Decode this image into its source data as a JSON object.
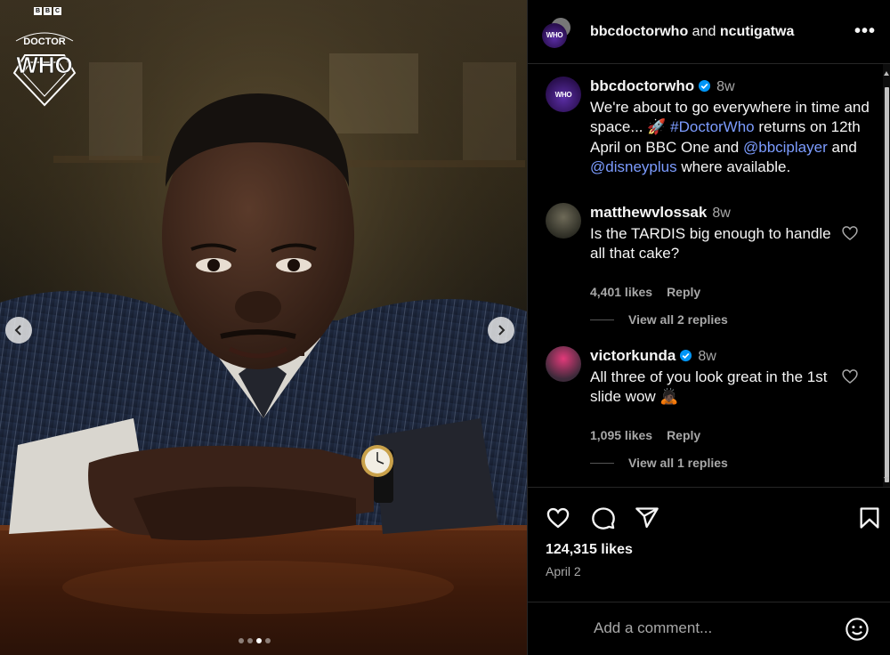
{
  "brand": {
    "bbc_letters": [
      "B",
      "B",
      "C"
    ],
    "logo_top": "DOCTOR",
    "logo_main": "WHO"
  },
  "media": {
    "prev_icon": "chevron-left-icon",
    "next_icon": "chevron-right-icon",
    "slide_count": 4,
    "active_slide": 3
  },
  "header": {
    "account1": "bbcdoctorwho",
    "joiner": "and",
    "account2": "ncutigatwa",
    "more_icon": "more-horizontal-icon",
    "more_label": "•••"
  },
  "caption": {
    "username": "bbcdoctorwho",
    "time": "8w",
    "text_1": "We're about to go everywhere in time and space... 🚀 ",
    "hashtag": "#DoctorWho",
    "text_2": " returns on 12th April on BBC One and ",
    "mention1": "@bbciplayer",
    "text_3": " and ",
    "mention2": "@disneyplus",
    "text_4": " where available."
  },
  "comments": [
    {
      "username": "matthewvlossak",
      "time": "8w",
      "text": "Is the TARDIS big enough to handle all that cake?",
      "likes": "4,401 likes",
      "reply": "Reply",
      "view_replies": "View all 2 replies"
    },
    {
      "username": "victorkunda",
      "time": "8w",
      "text": "All three of you look great in the 1st slide wow 🙇🏿",
      "likes": "1,095 likes",
      "reply": "Reply",
      "view_replies": "View all 1 replies"
    }
  ],
  "actions": {
    "like_icon": "heart-icon",
    "comment_icon": "comment-icon",
    "share_icon": "share-icon",
    "save_icon": "bookmark-icon"
  },
  "post": {
    "likes": "124,315 likes",
    "date": "April 2"
  },
  "comment_box": {
    "placeholder": "Add a comment...",
    "emoji_icon": "emoji-icon"
  },
  "colors": {
    "background": "#000000",
    "text": "#f5f5f5",
    "muted": "#a8a8a8",
    "link": "#7c9cff",
    "verified": "#0095f6"
  }
}
